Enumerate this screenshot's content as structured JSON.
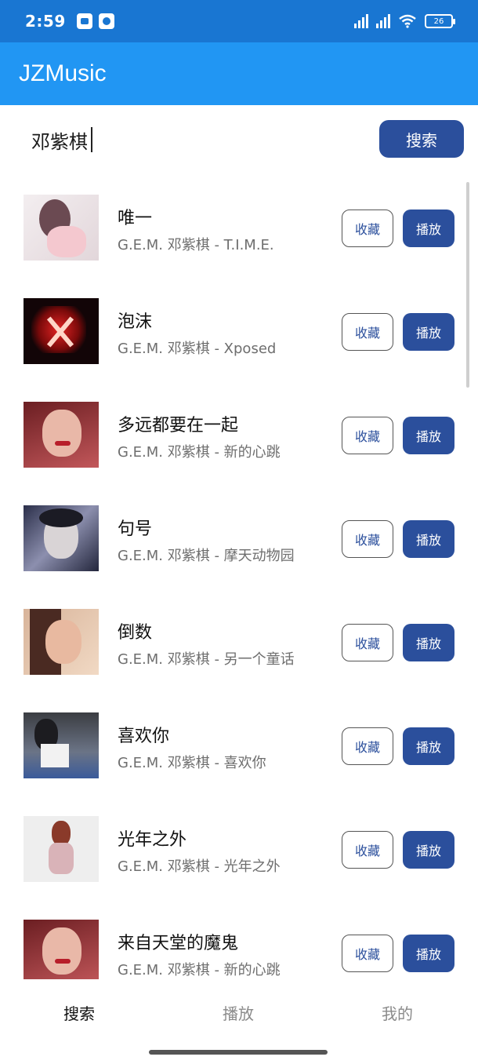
{
  "status_bar": {
    "time": "2:59",
    "battery": "26"
  },
  "app": {
    "title": "JZMusic"
  },
  "search": {
    "value": "邓紫棋",
    "button_label": "搜索"
  },
  "list": {
    "fav_label": "收藏",
    "play_label": "播放",
    "items": [
      {
        "title": "唯一",
        "subtitle": "G.E.M. 邓紫棋 - T.I.M.E."
      },
      {
        "title": "泡沫",
        "subtitle": "G.E.M. 邓紫棋 - Xposed"
      },
      {
        "title": "多远都要在一起",
        "subtitle": "G.E.M. 邓紫棋 - 新的心跳"
      },
      {
        "title": "句号",
        "subtitle": "G.E.M. 邓紫棋 - 摩天动物园"
      },
      {
        "title": "倒数",
        "subtitle": "G.E.M. 邓紫棋 - 另一个童话"
      },
      {
        "title": "喜欢你",
        "subtitle": "G.E.M. 邓紫棋 - 喜欢你"
      },
      {
        "title": "光年之外",
        "subtitle": "G.E.M. 邓紫棋 - 光年之外"
      },
      {
        "title": "来自天堂的魔鬼",
        "subtitle": "G.E.M. 邓紫棋 - 新的心跳"
      }
    ]
  },
  "bottom_nav": {
    "tabs": [
      {
        "label": "搜索"
      },
      {
        "label": "播放"
      },
      {
        "label": "我的"
      }
    ]
  },
  "colors": {
    "status_bar": "#1976d2",
    "app_bar": "#2196f3",
    "accent": "#2b4f9c"
  }
}
